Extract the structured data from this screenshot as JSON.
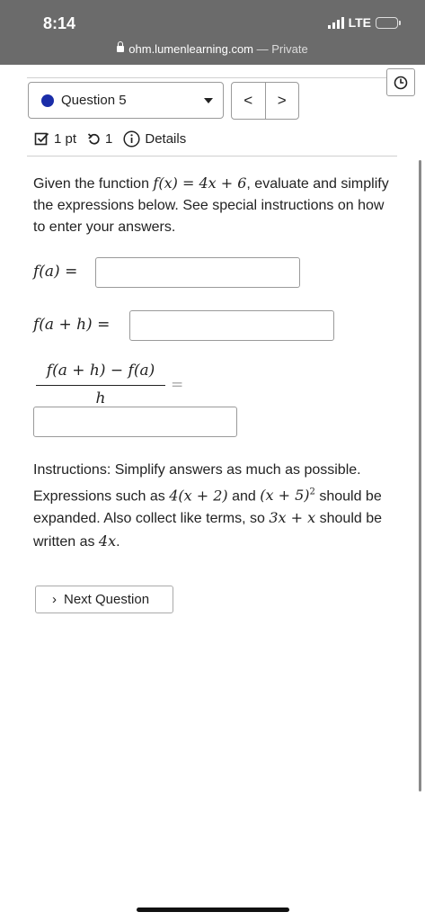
{
  "status_bar": {
    "time": "8:14",
    "network": "LTE",
    "url": "ohm.lumenlearning.com",
    "url_suffix": " — Private"
  },
  "question_nav": {
    "selected_question": "Question 5",
    "prev_label": "<",
    "next_label": ">"
  },
  "meta": {
    "points": "1 pt",
    "attempts": "1",
    "details_label": "Details"
  },
  "prompt": {
    "part1": "Given the function ",
    "f_name": "f",
    "f_arg": "(x)",
    "equals": " = ",
    "rhs": "4x + 6",
    "part2": ", evaluate and simplify the expressions below. See special instructions on how to enter your answers."
  },
  "equations": {
    "eq1_label": "f(a)",
    "eq2_label": "f(a + h)",
    "frac_numerator": "f(a + h) − f(a)",
    "frac_denominator": "h",
    "equals_sign": "=",
    "answer1": "",
    "answer2": "",
    "answer3": ""
  },
  "instructions": {
    "t1": "Instructions: Simplify answers as much as possible. Expressions such as ",
    "m1": "4(x + 2)",
    "t2": " and ",
    "m2": "(x + 5)",
    "m2_exp": "2",
    "t3": " should be expanded. Also collect like terms, so ",
    "m3": "3x + x",
    "t4": " should be written as ",
    "m4": "4x",
    "t5": "."
  },
  "next_button": {
    "label": "Next Question"
  },
  "colors": {
    "status_bar": "#6b6b6b",
    "question_dot": "#1a2da8",
    "battery": "#f5d400"
  }
}
